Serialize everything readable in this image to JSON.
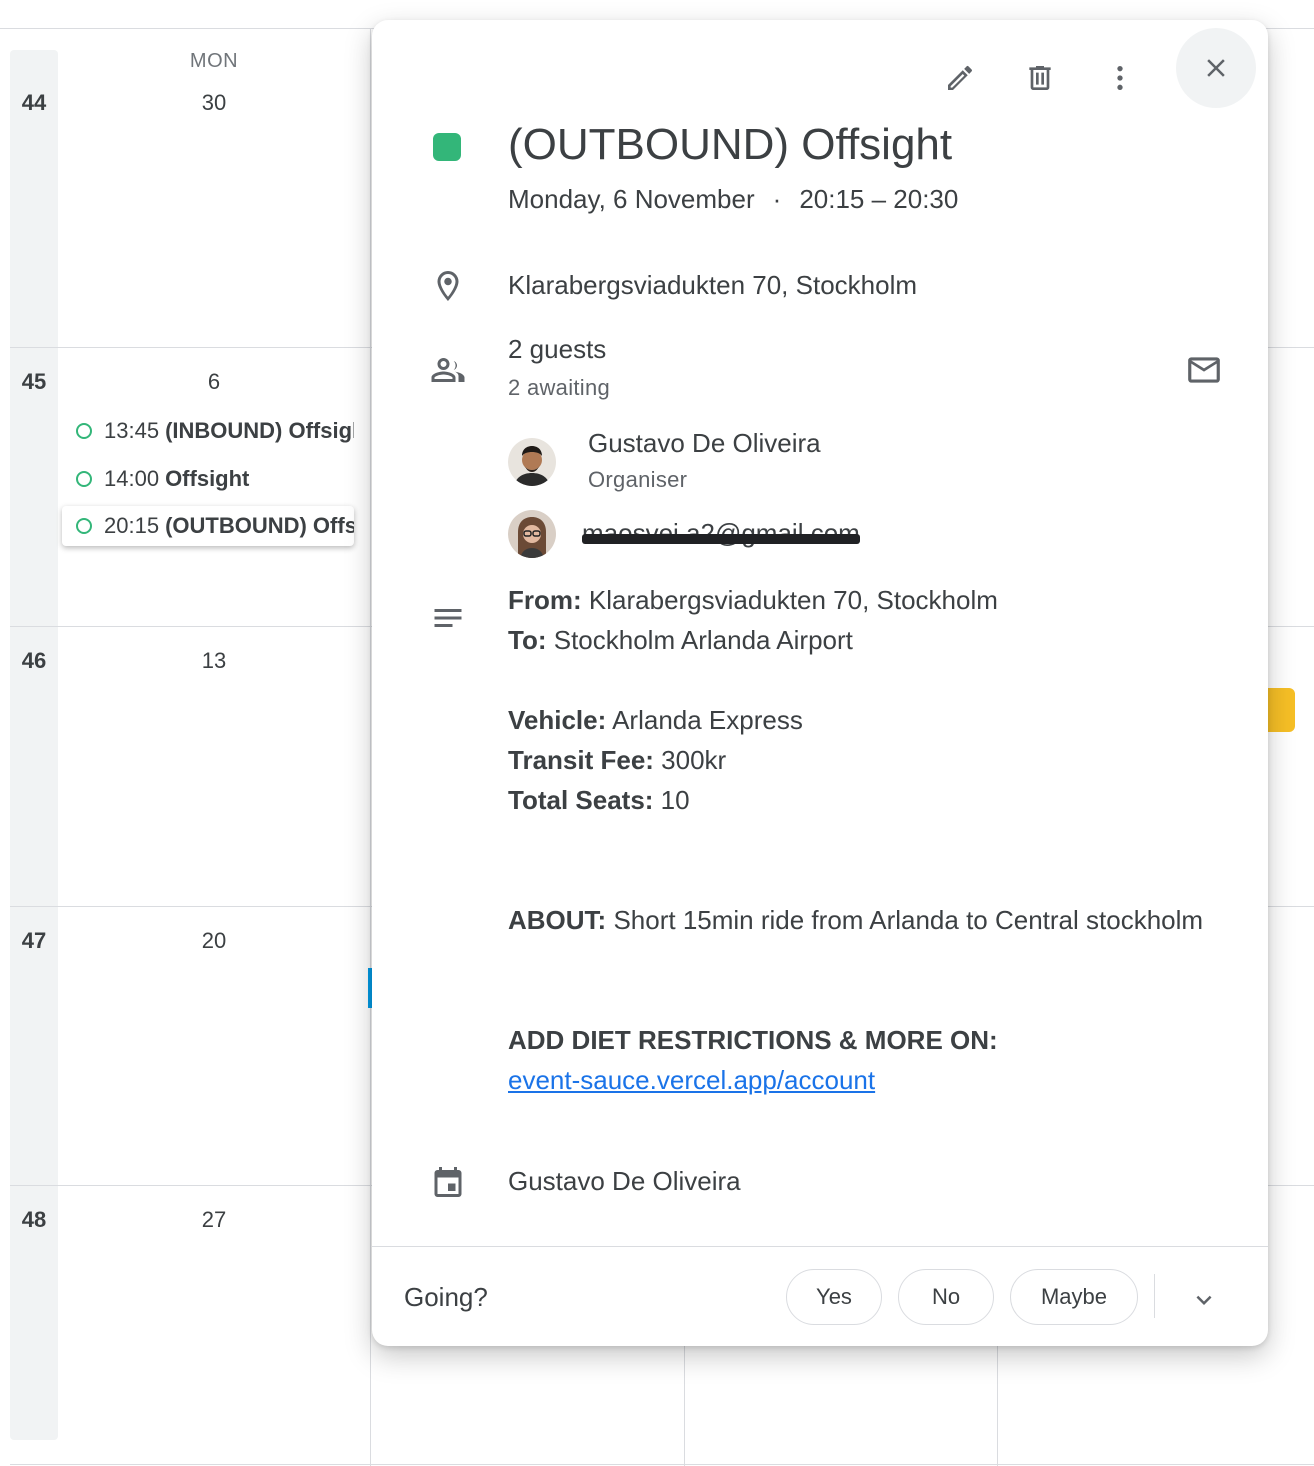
{
  "calendar": {
    "day_header": "MON",
    "weeks": [
      {
        "number": "44",
        "day": "30"
      },
      {
        "number": "45",
        "day": "6"
      },
      {
        "number": "46",
        "day": "13"
      },
      {
        "number": "47",
        "day": "20"
      },
      {
        "number": "48",
        "day": "27"
      }
    ],
    "events": [
      {
        "time": "13:45",
        "title": "(INBOUND) Offsight"
      },
      {
        "time": "14:00",
        "title": "Offsight"
      },
      {
        "time": "20:15",
        "title": "(OUTBOUND) Offsight"
      }
    ]
  },
  "popup": {
    "event_color": "#33b679",
    "toolbar": {
      "edit_icon": "pencil-icon",
      "delete_icon": "trash-icon",
      "more_icon": "more-vert-icon",
      "close_icon": "close-icon"
    },
    "title": "(OUTBOUND) Offsight",
    "date": "Monday, 6 November",
    "separator": "·",
    "time_range": "20:15 – 20:30",
    "location": "Klarabergsviadukten 70, Stockholm",
    "guests": {
      "count_label": "2 guests",
      "status_label": "2 awaiting",
      "list": [
        {
          "name": "Gustavo De Oliveira",
          "role": "Organiser"
        },
        {
          "name": "maosvei a2@gmail.com"
        }
      ]
    },
    "description": {
      "from_label": "From:",
      "from_value": "Klarabergsviadukten 70, Stockholm",
      "to_label": "To:",
      "to_value": "Stockholm Arlanda Airport",
      "vehicle_label": "Vehicle:",
      "vehicle_value": "Arlanda Express",
      "fee_label": "Transit Fee:",
      "fee_value": "300kr",
      "seats_label": "Total Seats:",
      "seats_value": "10",
      "about_label": "ABOUT:",
      "about_value": "Short 15min ride from Arlanda to Central stockholm",
      "diet_label": "ADD DIET RESTRICTIONS & MORE ON:",
      "link_text": "event-sauce.vercel.app/account"
    },
    "calendar_owner": "Gustavo De Oliveira",
    "rsvp": {
      "prompt": "Going?",
      "yes": "Yes",
      "no": "No",
      "maybe": "Maybe"
    }
  }
}
